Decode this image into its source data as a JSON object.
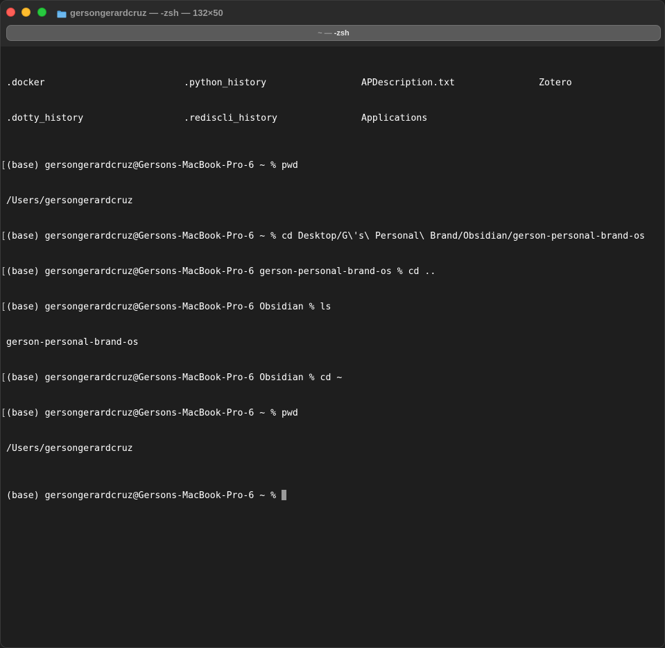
{
  "window": {
    "title": "gersongerardcruz — -zsh — 132×50",
    "tab": {
      "prefix": "~ — ",
      "label": "-zsh"
    },
    "folder_icon": "folder-icon",
    "colors": {
      "close": "#fe5f57",
      "minimize": "#febc2e",
      "maximize": "#28c840",
      "background": "#1e1e1e",
      "text": "#ffffff",
      "cursor": "#9a9a9a"
    }
  },
  "terminal": {
    "ls_rows": [
      [
        ".docker",
        ".python_history",
        "APDescription.txt",
        "Zotero"
      ],
      [
        ".dotty_history",
        ".rediscli_history",
        "Applications",
        ""
      ]
    ],
    "lines": [
      {
        "mark": "[",
        "text": "(base) gersongerardcruz@Gersons-MacBook-Pro-6 ~ % pwd"
      },
      {
        "mark": "",
        "text": "/Users/gersongerardcruz"
      },
      {
        "mark": "[",
        "text": "(base) gersongerardcruz@Gersons-MacBook-Pro-6 ~ % cd Desktop/G\\'s\\ Personal\\ Brand/Obsidian/gerson-personal-brand-os"
      },
      {
        "mark": "[",
        "text": "(base) gersongerardcruz@Gersons-MacBook-Pro-6 gerson-personal-brand-os % cd .."
      },
      {
        "mark": "[",
        "text": "(base) gersongerardcruz@Gersons-MacBook-Pro-6 Obsidian % ls"
      },
      {
        "mark": "",
        "text": "gerson-personal-brand-os"
      },
      {
        "mark": "[",
        "text": "(base) gersongerardcruz@Gersons-MacBook-Pro-6 Obsidian % cd ~"
      },
      {
        "mark": "[",
        "text": "(base) gersongerardcruz@Gersons-MacBook-Pro-6 ~ % pwd"
      },
      {
        "mark": "",
        "text": "/Users/gersongerardcruz"
      }
    ],
    "prompt": "(base) gersongerardcruz@Gersons-MacBook-Pro-6 ~ % "
  }
}
